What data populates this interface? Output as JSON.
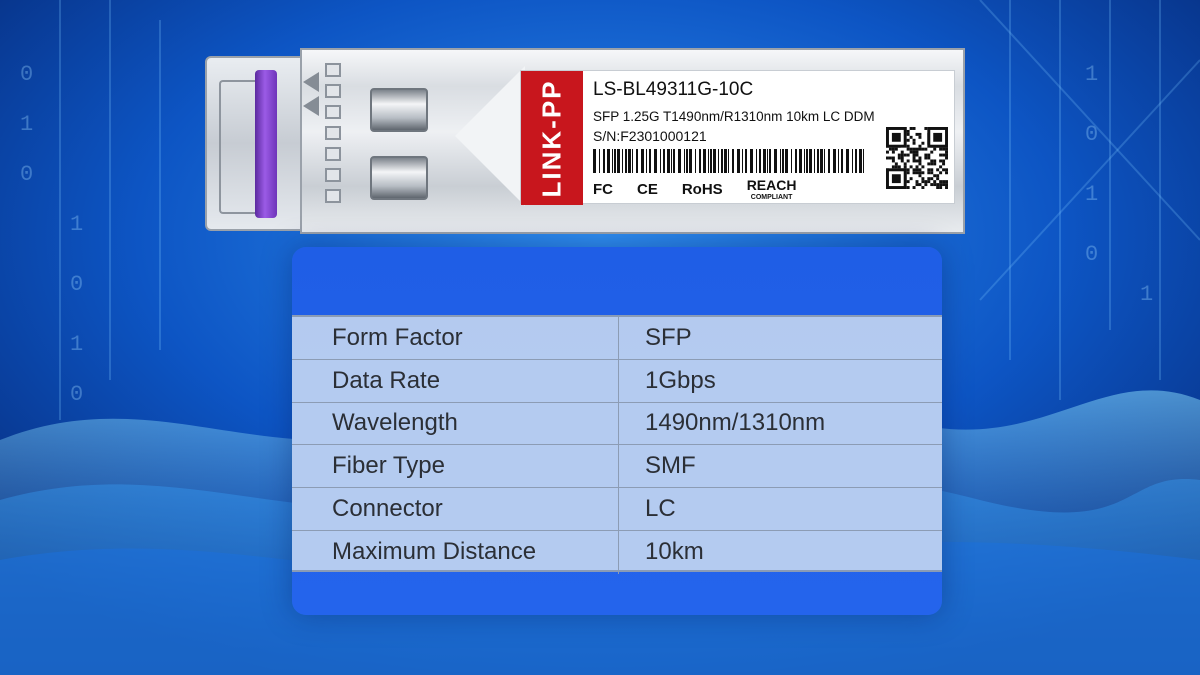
{
  "module": {
    "brand": "LINK-PP",
    "model": "LS-BL49311G-10C",
    "spec_line": "SFP 1.25G T1490nm/R1310nm 10km LC DDM",
    "serial": "S/N:F2301000121",
    "certifications": [
      "FC",
      "CE",
      "RoHS"
    ],
    "reach_main": "REACH",
    "reach_sub": "COMPLIANT"
  },
  "specs": [
    {
      "label": "Form Factor",
      "value": "SFP"
    },
    {
      "label": "Data Rate",
      "value": "1Gbps"
    },
    {
      "label": "Wavelength",
      "value": "1490nm/1310nm"
    },
    {
      "label": "Fiber Type",
      "value": "SMF"
    },
    {
      "label": "Connector",
      "value": "LC"
    },
    {
      "label": "Maximum Distance",
      "value": "10km"
    }
  ],
  "colors": {
    "brand_red": "#c8161d",
    "bail_purple": "#8a4bd6",
    "panel_blue": "#2262ea",
    "background_blue": "#0a3e9c"
  }
}
